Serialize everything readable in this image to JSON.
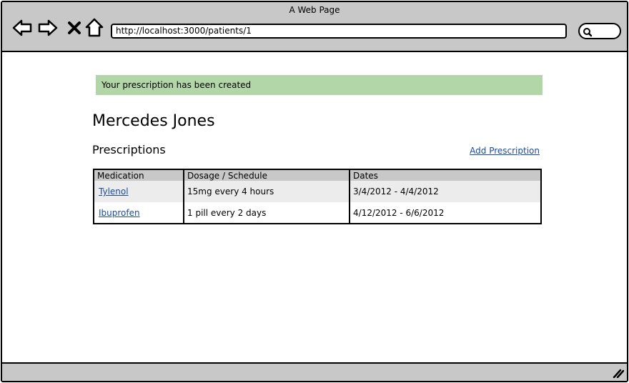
{
  "window": {
    "title": "A Web Page"
  },
  "toolbar": {
    "back_icon": "back-arrow-icon",
    "forward_icon": "forward-arrow-icon",
    "stop_icon": "close-icon",
    "home_icon": "home-icon",
    "url": "http://localhost:3000/patients/1",
    "search_icon": "search-icon"
  },
  "flash": {
    "message": "Your prescription has been created"
  },
  "patient": {
    "name": "Mercedes Jones"
  },
  "prescriptions": {
    "title": "Prescriptions",
    "add_label": "Add Prescription",
    "columns": [
      "Medication",
      "Dosage / Schedule",
      "Dates"
    ],
    "rows": [
      {
        "medication": "Tylenol",
        "dosage": "15mg every 4 hours",
        "dates": "3/4/2012 - 4/4/2012"
      },
      {
        "medication": "Ibuprofen",
        "dosage": "1 pill every 2 days",
        "dates": "4/12/2012 - 6/6/2012"
      }
    ]
  },
  "colors": {
    "chrome": "#c8c8c8",
    "flash_bg": "#b3d6a8",
    "link": "#1a4a9a",
    "row_alt": "#ececec"
  }
}
